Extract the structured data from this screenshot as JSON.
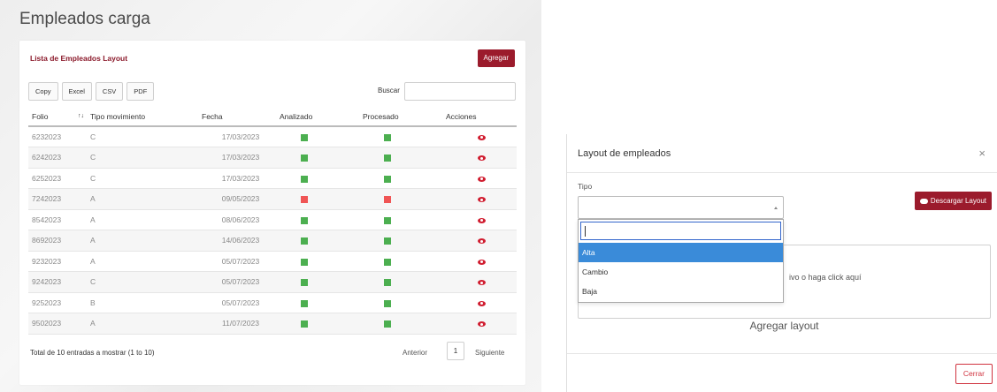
{
  "left": {
    "page_title": "Empleados carga",
    "card_title": "Lista de Empleados Layout",
    "add_button": "Agregar",
    "tools": [
      "Copy",
      "Excel",
      "CSV",
      "PDF"
    ],
    "search_label": "Buscar",
    "search_value": "",
    "columns": {
      "folio": "Folio",
      "sort": "↑↓",
      "tipo": "Tipo movimiento",
      "fecha": "Fecha",
      "analizado": "Analizado",
      "procesado": "Procesado",
      "acciones": "Acciones"
    },
    "rows": [
      {
        "folio": "6232023",
        "tipo": "C",
        "fecha": "17/03/2023",
        "analizado": "green",
        "procesado": "green"
      },
      {
        "folio": "6242023",
        "tipo": "C",
        "fecha": "17/03/2023",
        "analizado": "green",
        "procesado": "green"
      },
      {
        "folio": "6252023",
        "tipo": "C",
        "fecha": "17/03/2023",
        "analizado": "green",
        "procesado": "green"
      },
      {
        "folio": "7242023",
        "tipo": "A",
        "fecha": "09/05/2023",
        "analizado": "red",
        "procesado": "red"
      },
      {
        "folio": "8542023",
        "tipo": "A",
        "fecha": "08/06/2023",
        "analizado": "green",
        "procesado": "green"
      },
      {
        "folio": "8692023",
        "tipo": "A",
        "fecha": "14/06/2023",
        "analizado": "green",
        "procesado": "green"
      },
      {
        "folio": "9232023",
        "tipo": "A",
        "fecha": "05/07/2023",
        "analizado": "green",
        "procesado": "green"
      },
      {
        "folio": "9242023",
        "tipo": "C",
        "fecha": "05/07/2023",
        "analizado": "green",
        "procesado": "green"
      },
      {
        "folio": "9252023",
        "tipo": "B",
        "fecha": "05/07/2023",
        "analizado": "green",
        "procesado": "green"
      },
      {
        "folio": "9502023",
        "tipo": "A",
        "fecha": "11/07/2023",
        "analizado": "green",
        "procesado": "green"
      }
    ],
    "footer_total": "Total de 10 entradas a mostrar (1 to 10)",
    "pager_prev": "Anterior",
    "pager_page": "1",
    "pager_next": "Siguiente"
  },
  "modal": {
    "title": "Layout de empleados",
    "close_glyph": "×",
    "tipo_label": "Tipo",
    "select_value": "",
    "download_button": "Descargar Layout",
    "drop_text": "ivo o haga click aquí",
    "agregar_layout": "Agregar layout",
    "cerrar_button": "Cerrar",
    "dropdown_search": "",
    "options": [
      "Alta",
      "Cambio",
      "Baja"
    ],
    "selected_option": "Alta"
  },
  "colors": {
    "brand": "#9b1b2c",
    "status_green": "#4caf50",
    "status_red": "#f05555",
    "eye_icon": "#d01c2f",
    "highlight": "#3a8bd9"
  },
  "icons": [
    "eye-icon",
    "cloud-download-icon",
    "close-icon",
    "caret-up-icon",
    "sort-icon"
  ]
}
